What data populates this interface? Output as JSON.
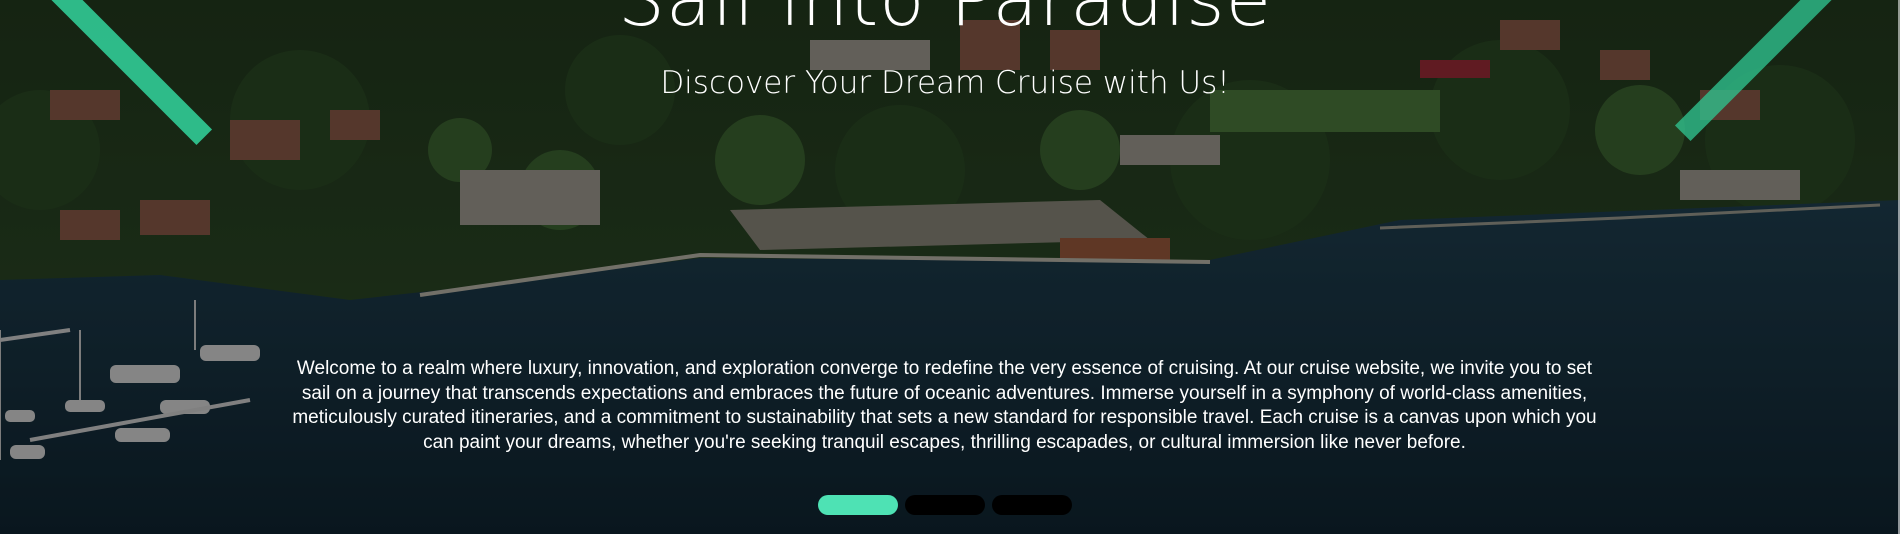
{
  "hero": {
    "title": "Sail into Paradise",
    "subtitle": "Discover Your Dream Cruise with Us!",
    "body": "Welcome to a realm where luxury, innovation, and exploration converge to redefine the very essence of cruising. At our cruise website, we invite you to set sail on a journey that transcends expectations and embraces the future of oceanic adventures. Immerse yourself in a symphony of world-class amenities, meticulously curated itineraries, and a commitment to sustainability that sets a new standard for responsible travel. Each cruise is a canvas upon which you can paint your dreams, whether you're seeking tranquil escapes, thrilling escapades, or cultural immersion like never before."
  },
  "slider": {
    "slide_count": 3,
    "active_index": 1
  },
  "colors": {
    "accent": "#2fc38f",
    "active_dot": "#4ee2b4",
    "inactive_dot": "#000000",
    "text": "#ffffff"
  },
  "icons": {
    "previous": "chevron-left-icon",
    "next": "chevron-right-icon"
  }
}
